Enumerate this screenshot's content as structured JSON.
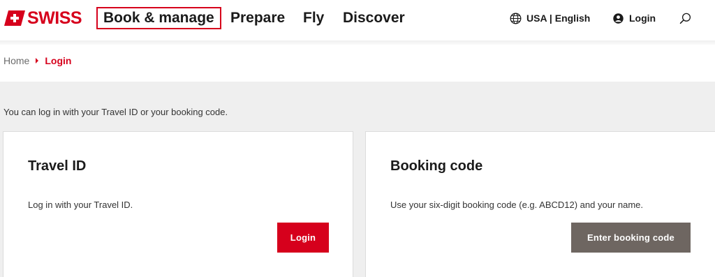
{
  "brand": {
    "name": "SWISS",
    "color": "#d6001c",
    "icon": "swiss-flag-logo"
  },
  "nav": {
    "items": [
      {
        "label": "Book & manage",
        "active": true
      },
      {
        "label": "Prepare",
        "active": false
      },
      {
        "label": "Fly",
        "active": false
      },
      {
        "label": "Discover",
        "active": false
      }
    ]
  },
  "utility": {
    "locale": {
      "label": "USA | English",
      "icon": "globe-icon"
    },
    "login": {
      "label": "Login",
      "icon": "user-icon"
    },
    "search": {
      "icon": "search-icon"
    }
  },
  "breadcrumb": {
    "home": "Home",
    "current": "Login"
  },
  "intro": "You can log in with your Travel ID or your booking code.",
  "cards": {
    "travel_id": {
      "title": "Travel ID",
      "text": "Log in with your Travel ID.",
      "button": "Login",
      "button_color": "#d6001c"
    },
    "booking_code": {
      "title": "Booking code",
      "text": "Use your six-digit booking code (e.g. ABCD12) and your name.",
      "button": "Enter booking code",
      "button_color": "#6e6661"
    }
  }
}
